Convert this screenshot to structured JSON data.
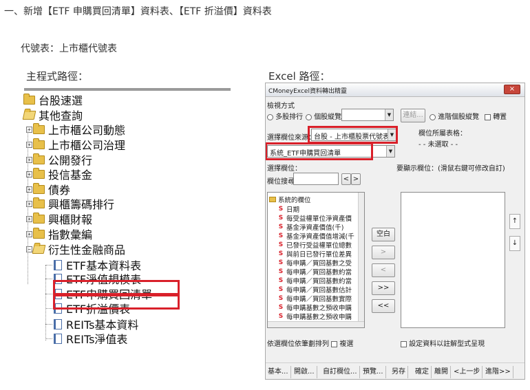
{
  "document": {
    "heading": "一、新增【ETF 申購買回清單】資料表、【ETF 折溢價】資料表",
    "code_table": "代號表：上市櫃代號表",
    "main_path_label": "主程式路徑：",
    "excel_path_label": "Excel 路徑："
  },
  "tree": {
    "items": [
      {
        "label": "台股速選",
        "expander": "",
        "icon": "folder-icon"
      },
      {
        "label": "其他查詢",
        "expander": "",
        "icon": "open-folder-icon"
      },
      {
        "label": "上市櫃公司動態",
        "expander": "+",
        "icon": "folder-icon"
      },
      {
        "label": "上市櫃公司治理",
        "expander": "+",
        "icon": "folder-icon"
      },
      {
        "label": "公開發行",
        "expander": "+",
        "icon": "folder-icon"
      },
      {
        "label": "投信基金",
        "expander": "+",
        "icon": "folder-icon"
      },
      {
        "label": "債券",
        "expander": "+",
        "icon": "folder-icon"
      },
      {
        "label": "興櫃籌碼排行",
        "expander": "+",
        "icon": "folder-icon"
      },
      {
        "label": "興櫃財報",
        "expander": "+",
        "icon": "folder-icon"
      },
      {
        "label": "指數彙編",
        "expander": "+",
        "icon": "folder-icon"
      },
      {
        "label": "衍生性金融商品",
        "expander": "−",
        "icon": "open-folder-icon"
      },
      {
        "label": "ETF基本資料表",
        "expander": "",
        "icon": "document-icon"
      },
      {
        "label": "ETF淨值規模表",
        "expander": "",
        "icon": "document-icon"
      },
      {
        "label": "ETF申購買回清單",
        "expander": "",
        "icon": "document-icon"
      },
      {
        "label": "ETF折溢價表",
        "expander": "",
        "icon": "document-icon"
      },
      {
        "label": "REITs基本資料",
        "expander": "",
        "icon": "document-icon"
      },
      {
        "label": "REITs淨值表",
        "expander": "",
        "icon": "document-icon"
      }
    ]
  },
  "dialog": {
    "title": "CMoneyExcel資料轉出精靈",
    "close_icon": "×",
    "mode_label": "檢視方式",
    "multi_stock_label": "多股排行",
    "single_stock_label": "個股縱覽",
    "connect_button": "連結...",
    "advanced_label": "進階個股縱覽",
    "transpose_label": "轉置",
    "source_label": "選擇欄位來源：",
    "source_value": "台股 - 上市櫃股票代號表",
    "table_value": "系統_ETF申購買回清單",
    "belong_label": "欄位所屬表格：",
    "belong_value": "- - 未選取 - -",
    "choose_field_label": "選擇欄位：",
    "search_label": "欄位搜尋：",
    "prev_arrow": "<",
    "next_arrow": ">",
    "display_label": "要顯示欄位：(滑鼠右鍵可修改自訂)",
    "field_root": "系統的欄位",
    "fields": [
      "日期",
      "每受益權單位淨資產價",
      "基金淨資產價值(千)",
      "基金淨資產價值增減(千",
      "已發行受益權單位總數",
      "與前日已發行單位差異",
      "每申購／買回基數之受",
      "每申購／買回基數約當",
      "每申購／買回基數約當",
      "每申購／買回基數估計",
      "每申購／買回基數實際",
      "每申購基數之預收申購",
      "每申購基數之預收申購"
    ],
    "clear_button": "空白",
    "move_right": ">",
    "move_left": "<",
    "move_all_right": ">>",
    "move_all_left": "<<",
    "up_arrow": "↑",
    "down_arrow": "↓",
    "sort_label": "依選欄位依筆劃排列",
    "multi_select_label": "複選",
    "note_label": "設定資料以註解型式呈現",
    "bottom_buttons": [
      "基本...",
      "開啟...",
      "自訂欄位...",
      "預覽...",
      "另存",
      "確定",
      "離開",
      "<上一步",
      "進階>>"
    ]
  },
  "colors": {
    "highlight_red": "#d9202a",
    "folder_yellow": "#e8c04a"
  }
}
